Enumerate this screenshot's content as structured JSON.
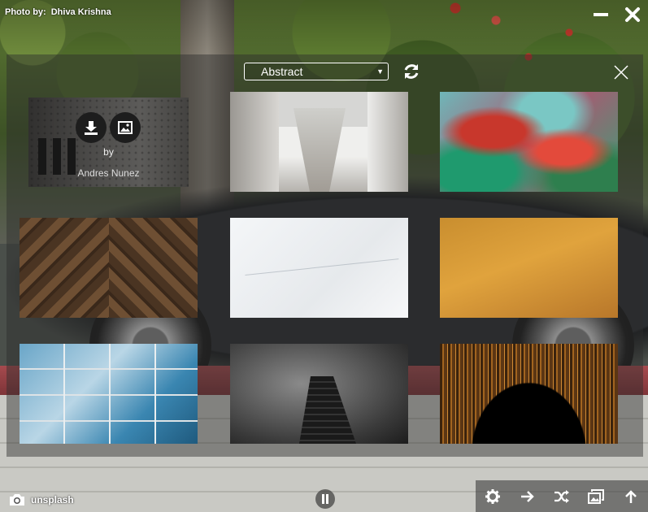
{
  "header": {
    "photo_credit_label": "Photo by:",
    "photo_credit_name": "Dhiva Krishna",
    "minimize_icon": "minimize-icon",
    "close_icon": "close-icon"
  },
  "gallery_panel": {
    "category_select": {
      "selected": "Abstract"
    },
    "refresh_icon": "refresh-icon",
    "close_icon": "close-thin-icon",
    "items": [
      {
        "id": "arched-building",
        "hovered": true,
        "by_label": "by",
        "author": "Andres Nunez",
        "actions": [
          "download-icon",
          "image-icon"
        ]
      },
      {
        "id": "white-hallway"
      },
      {
        "id": "colorful-fluid-art"
      },
      {
        "id": "wood-chevron"
      },
      {
        "id": "white-wall-texture"
      },
      {
        "id": "gold-texture"
      },
      {
        "id": "glass-facade"
      },
      {
        "id": "bw-skyscraper"
      },
      {
        "id": "golden-light-streaks"
      }
    ]
  },
  "footer": {
    "camera_icon": "camera-icon",
    "source_label": "unsplash",
    "pause_icon": "pause-icon",
    "toolbar": [
      "gear-icon",
      "arrow-right-icon",
      "shuffle-icon",
      "gallery-icon",
      "arrow-up-icon"
    ]
  },
  "colors": {
    "panel_overlay": "#2d2d2d",
    "toolbar_bg": "#3c3c3c",
    "text": "#ffffff"
  }
}
